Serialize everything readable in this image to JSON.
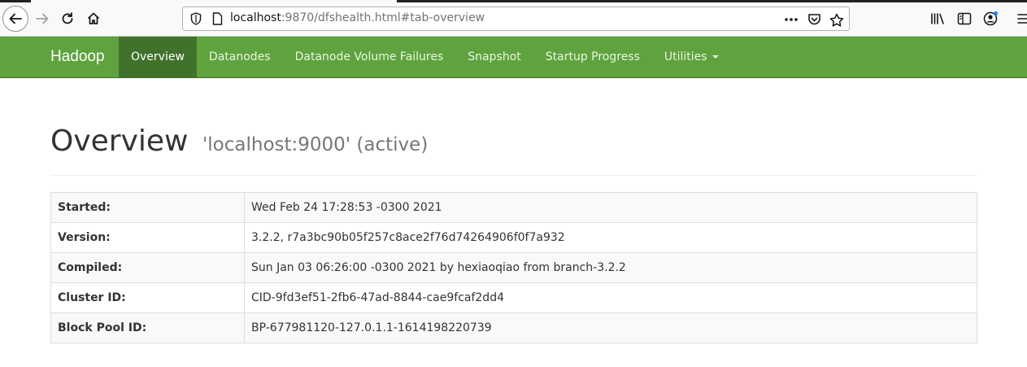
{
  "browser": {
    "url_host": "localhost",
    "url_rest": ":9870/dfshealth.html#tab-overview"
  },
  "navbar": {
    "brand": "Hadoop",
    "items": [
      {
        "label": "Overview",
        "active": true
      },
      {
        "label": "Datanodes"
      },
      {
        "label": "Datanode Volume Failures"
      },
      {
        "label": "Snapshot"
      },
      {
        "label": "Startup Progress"
      },
      {
        "label": "Utilities"
      }
    ],
    "color": "#5fa33e",
    "active_color": "#41722b"
  },
  "header": {
    "title": "Overview",
    "subtitle": "'localhost:9000' (active)"
  },
  "info_table": [
    {
      "label": "Started:",
      "value": "Wed Feb 24 17:28:53 -0300 2021"
    },
    {
      "label": "Version:",
      "value": "3.2.2, r7a3bc90b05f257c8ace2f76d74264906f0f7a932"
    },
    {
      "label": "Compiled:",
      "value": "Sun Jan 03 06:26:00 -0300 2021 by hexiaoqiao from branch-3.2.2"
    },
    {
      "label": "Cluster ID:",
      "value": "CID-9fd3ef51-2fb6-47ad-8844-cae9fcaf2dd4"
    },
    {
      "label": "Block Pool ID:",
      "value": "BP-677981120-127.0.1.1-1614198220739"
    }
  ]
}
